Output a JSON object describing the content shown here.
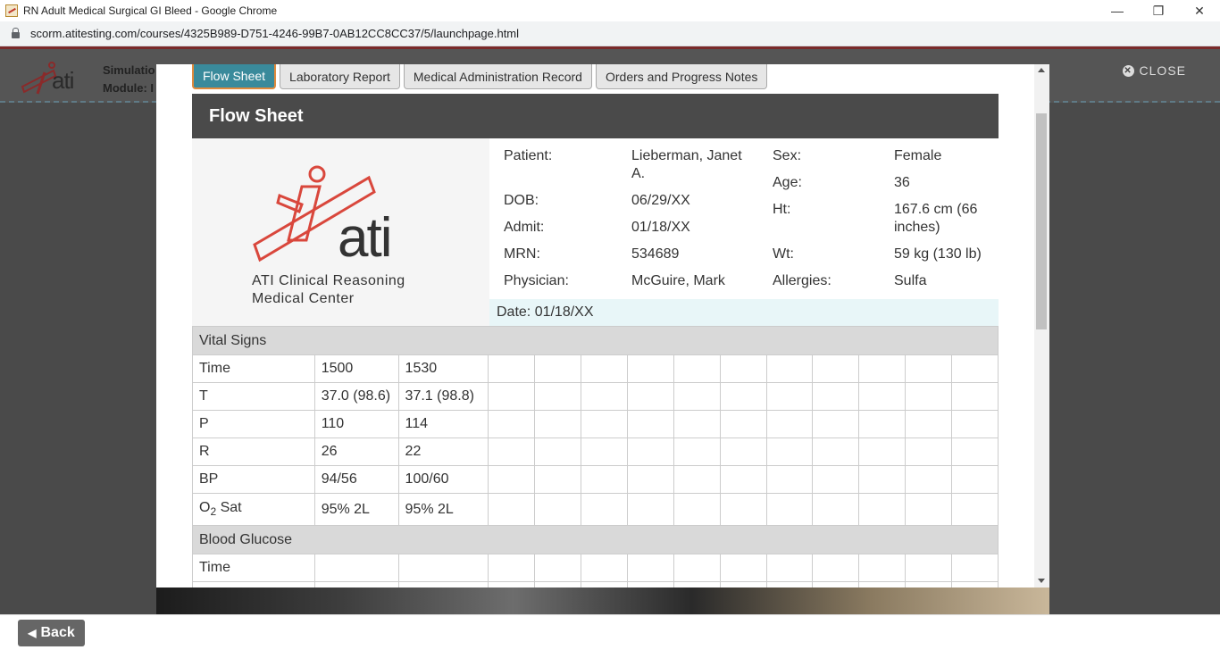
{
  "browser": {
    "window_title": "RN Adult Medical Surgical GI Bleed - Google Chrome",
    "url": "scorm.atitesting.com/courses/4325B989-D751-4246-99B7-0AB12CC8CC37/5/launchpage.html",
    "minimize": "—",
    "restore": "❐",
    "close": "✕"
  },
  "background_page": {
    "logo_word": "ati",
    "simulation_label": "Simulatio",
    "module_label": "Module: I",
    "close_label": "CLOSE"
  },
  "tabs": [
    {
      "label": "Flow Sheet",
      "active": true
    },
    {
      "label": "Laboratory Report",
      "active": false
    },
    {
      "label": "Medical Administration Record",
      "active": false
    },
    {
      "label": "Orders and Progress Notes",
      "active": false
    }
  ],
  "flow_sheet": {
    "title": "Flow Sheet",
    "center_name_line1": "ATI Clinical Reasoning",
    "center_name_line2": "Medical Center",
    "logo_word": "ati",
    "patient": {
      "patient_label": "Patient:",
      "patient_value": "Lieberman, Janet A.",
      "dob_label": "DOB:",
      "dob_value": "06/29/XX",
      "admit_label": "Admit:",
      "admit_value": "01/18/XX",
      "mrn_label": "MRN:",
      "mrn_value": "534689",
      "physician_label": "Physician:",
      "physician_value": "McGuire, Mark",
      "sex_label": "Sex:",
      "sex_value": "Female",
      "age_label": "Age:",
      "age_value": "36",
      "ht_label": "Ht:",
      "ht_value": "167.6 cm (66 inches)",
      "wt_label": "Wt:",
      "wt_value": "59 kg (130 lb)",
      "allergies_label": "Allergies:",
      "allergies_value": "Sulfa"
    },
    "date_line": "Date: 01/18/XX",
    "vital_signs_header": "Vital Signs",
    "vitals": {
      "time_label": "Time",
      "time_1": "1500",
      "time_2": "1530",
      "t_label": "T",
      "t_1": "37.0 (98.6)",
      "t_2": "37.1 (98.8)",
      "p_label": "P",
      "p_1": "110",
      "p_2": "114",
      "r_label": "R",
      "r_1": "26",
      "r_2": "22",
      "bp_label": "BP",
      "bp_1": "94/56",
      "bp_2": "100/60",
      "o2_label_main": "O",
      "o2_label_sub": "2",
      "o2_label_rest": " Sat",
      "o2_1": "95% 2L",
      "o2_2": "95% 2L"
    },
    "blood_glucose_header": "Blood Glucose",
    "glucose_time_label": "Time"
  },
  "bottom": {
    "back_label": "Back"
  },
  "colors": {
    "active_tab": "#3a8a9b",
    "active_tab_border": "#e08a3c",
    "header_bar": "#4a4a4a",
    "logo_red": "#d9473c"
  }
}
